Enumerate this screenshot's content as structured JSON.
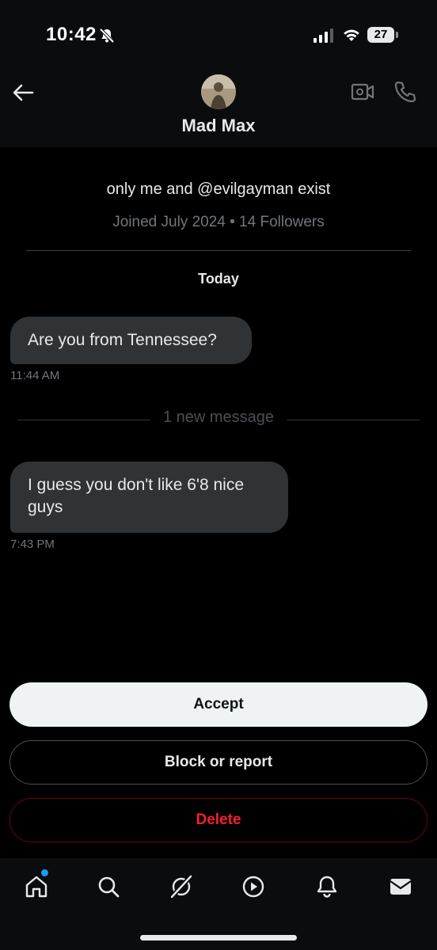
{
  "status": {
    "time": "10:42",
    "battery": "27"
  },
  "header": {
    "name": "Mad Max"
  },
  "profile": {
    "bio": "only me and @evilgayman exist",
    "meta": "Joined July 2024 • 14 Followers"
  },
  "conversation": {
    "date_label": "Today",
    "messages": [
      {
        "text": "Are you from Tennessee?",
        "time": "11:44 AM"
      },
      {
        "text": "I guess you don't like 6'8 nice guys",
        "time": "7:43 PM"
      }
    ],
    "new_message_label": "1 new message"
  },
  "actions": {
    "accept": "Accept",
    "block_report": "Block or report",
    "delete": "Delete"
  },
  "tabbar": {
    "icons": [
      "home-icon",
      "search-icon",
      "grok-icon",
      "video-icon",
      "bell-icon",
      "mail-icon"
    ]
  },
  "colors": {
    "background": "#000000",
    "bubble": "#2f3336",
    "muted": "#71767b",
    "danger": "#f4212e",
    "accent": "#1d9bf0"
  }
}
